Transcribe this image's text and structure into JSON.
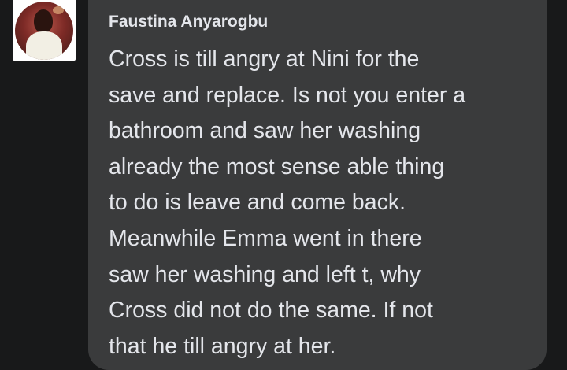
{
  "comment": {
    "author": "Faustina Anyarogbu",
    "avatar_icon": "user-profile-photo",
    "lines": [
      "Cross is till angry at Nini for the",
      "save and replace. Is not you enter a",
      "bathroom and saw her washing",
      "already the most sense able thing",
      "to do is leave and come back.",
      "Meanwhile Emma went in there",
      "saw her washing and left t, why",
      "Cross did not do the same. If not",
      "that he till angry at her."
    ]
  },
  "colors": {
    "background": "#18191a",
    "bubble": "#3a3b3c",
    "text": "#e4e6eb"
  }
}
